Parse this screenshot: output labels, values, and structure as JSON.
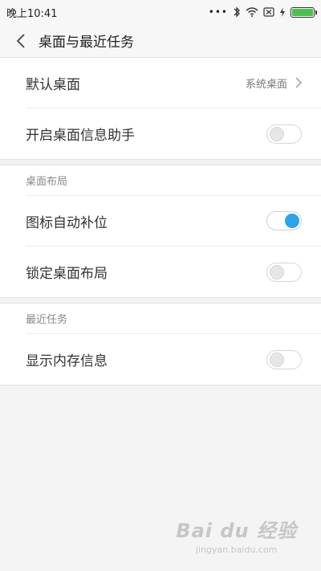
{
  "status_bar": {
    "time": "晚上10:41",
    "signal_dots": "•••",
    "battery_level": 1.0,
    "battery_color": "#48c24a"
  },
  "header": {
    "title": "桌面与最近任务"
  },
  "sections": {
    "main": {
      "default_desktop": {
        "label": "默认桌面",
        "value": "系统桌面"
      },
      "assistant": {
        "label": "开启桌面信息助手",
        "on": false
      }
    },
    "layout": {
      "header": "桌面布局",
      "auto_fill": {
        "label": "图标自动补位",
        "on": true
      },
      "lock_layout": {
        "label": "锁定桌面布局",
        "on": false
      }
    },
    "recent": {
      "header": "最近任务",
      "memory": {
        "label": "显示内存信息",
        "on": false
      }
    }
  },
  "accent_color": "#2aa2ec",
  "watermark": {
    "logo": "Bai du 经验",
    "url": "jingyan.baidu.com"
  }
}
